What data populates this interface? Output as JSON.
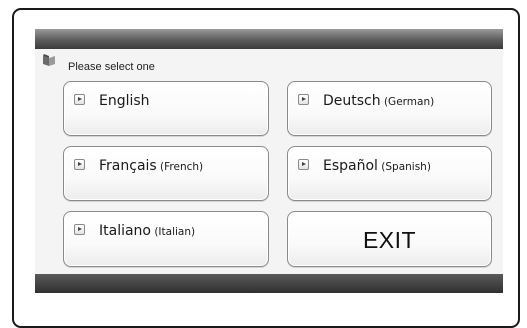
{
  "dialog": {
    "prompt": "Please select one"
  },
  "languages": [
    {
      "main": "English",
      "sub": ""
    },
    {
      "main": "Deutsch",
      "sub": " (German)"
    },
    {
      "main": "Français",
      "sub": " (French)"
    },
    {
      "main": "Español",
      "sub": " (Spanish)"
    },
    {
      "main": "Italiano",
      "sub": " (Italian)"
    }
  ],
  "exit_label": "EXIT",
  "icons": {
    "header": "book-icon",
    "button": "play-triangle-icon"
  }
}
